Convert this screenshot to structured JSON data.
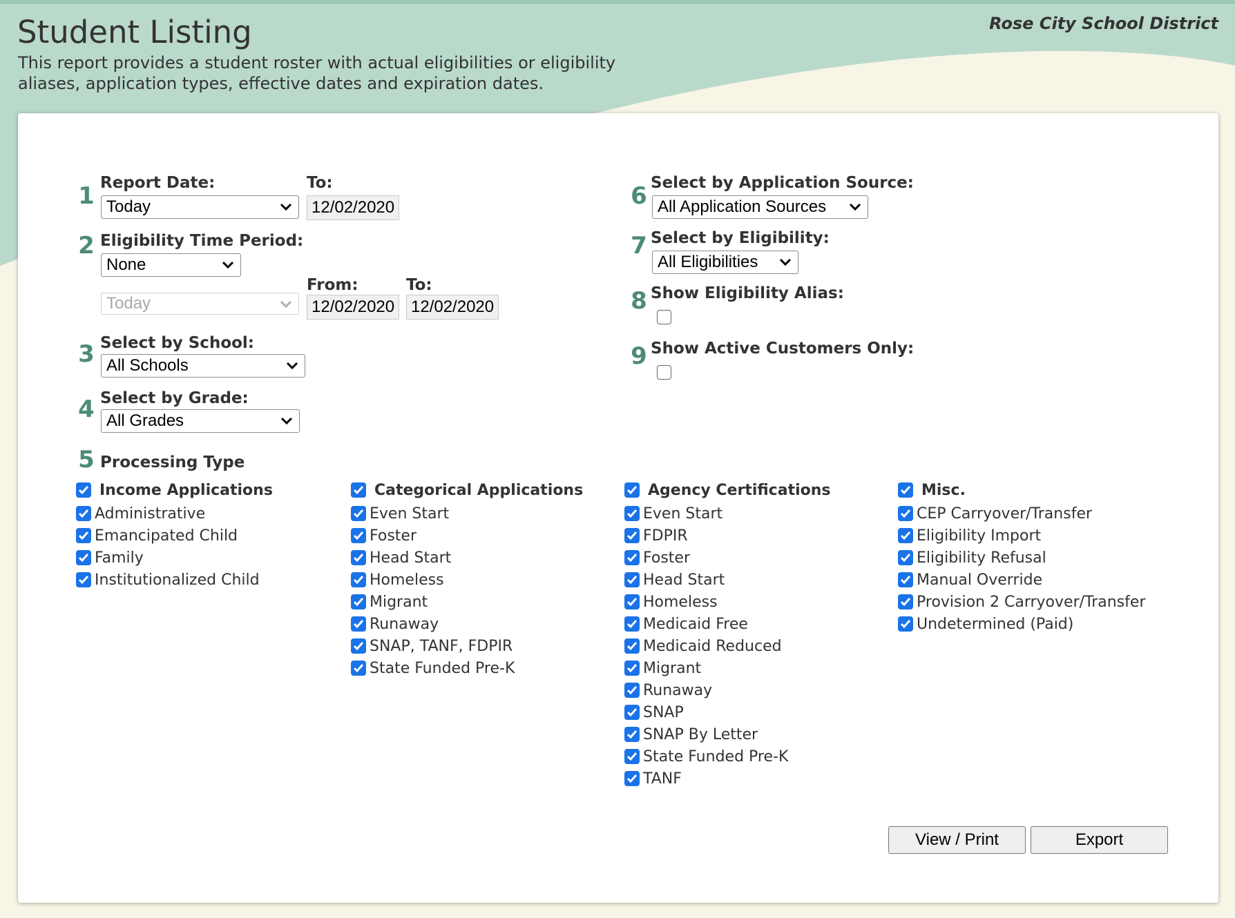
{
  "header": {
    "title": "Student Listing",
    "description": "This report provides a student roster with actual eligibilities or eligibility aliases, application types, effective dates and expiration dates.",
    "district": "Rose City School District"
  },
  "form": {
    "step1": {
      "number": "1",
      "label": "Report Date:",
      "select_value": "Today",
      "to_label": "To:",
      "to_date": "12/02/2020"
    },
    "step2": {
      "number": "2",
      "label": "Eligibility Time Period:",
      "select_value": "None",
      "range_select_value": "Today",
      "from_label": "From:",
      "from_date": "12/02/2020",
      "to_label": "To:",
      "to_date": "12/02/2020"
    },
    "step3": {
      "number": "3",
      "label": "Select by School:",
      "select_value": "All Schools"
    },
    "step4": {
      "number": "4",
      "label": "Select by Grade:",
      "select_value": "All Grades"
    },
    "step5": {
      "number": "5",
      "label": "Processing Type",
      "groups": [
        {
          "title": "Income Applications",
          "checked": true,
          "items": [
            "Administrative",
            "Emancipated Child",
            "Family",
            "Institutionalized Child"
          ]
        },
        {
          "title": "Categorical Applications",
          "checked": true,
          "items": [
            "Even Start",
            "Foster",
            "Head Start",
            "Homeless",
            "Migrant",
            "Runaway",
            "SNAP, TANF, FDPIR",
            "State Funded Pre-K"
          ]
        },
        {
          "title": "Agency Certifications",
          "checked": true,
          "items": [
            "Even Start",
            "FDPIR",
            "Foster",
            "Head Start",
            "Homeless",
            "Medicaid Free",
            "Medicaid Reduced",
            "Migrant",
            "Runaway",
            "SNAP",
            "SNAP By Letter",
            "State Funded Pre-K",
            "TANF"
          ]
        },
        {
          "title": "Misc.",
          "checked": true,
          "items": [
            "CEP Carryover/Transfer",
            "Eligibility Import",
            "Eligibility Refusal",
            "Manual Override",
            "Provision 2 Carryover/Transfer",
            "Undetermined (Paid)"
          ]
        }
      ]
    },
    "step6": {
      "number": "6",
      "label": "Select by Application Source:",
      "select_value": "All Application Sources"
    },
    "step7": {
      "number": "7",
      "label": "Select by Eligibility:",
      "select_value": "All Eligibilities"
    },
    "step8": {
      "number": "8",
      "label": "Show Eligibility Alias:",
      "checked": false
    },
    "step9": {
      "number": "9",
      "label": "Show Active Customers Only:",
      "checked": false
    }
  },
  "buttons": {
    "view_print": "View / Print",
    "export": "Export"
  },
  "colors": {
    "accent": "#4d8c74",
    "header_band": "#b9d9cb",
    "checkbox": "#1a73e8"
  },
  "icons": {
    "select": "chevron-down-icon",
    "checked": "checkmark-icon"
  }
}
